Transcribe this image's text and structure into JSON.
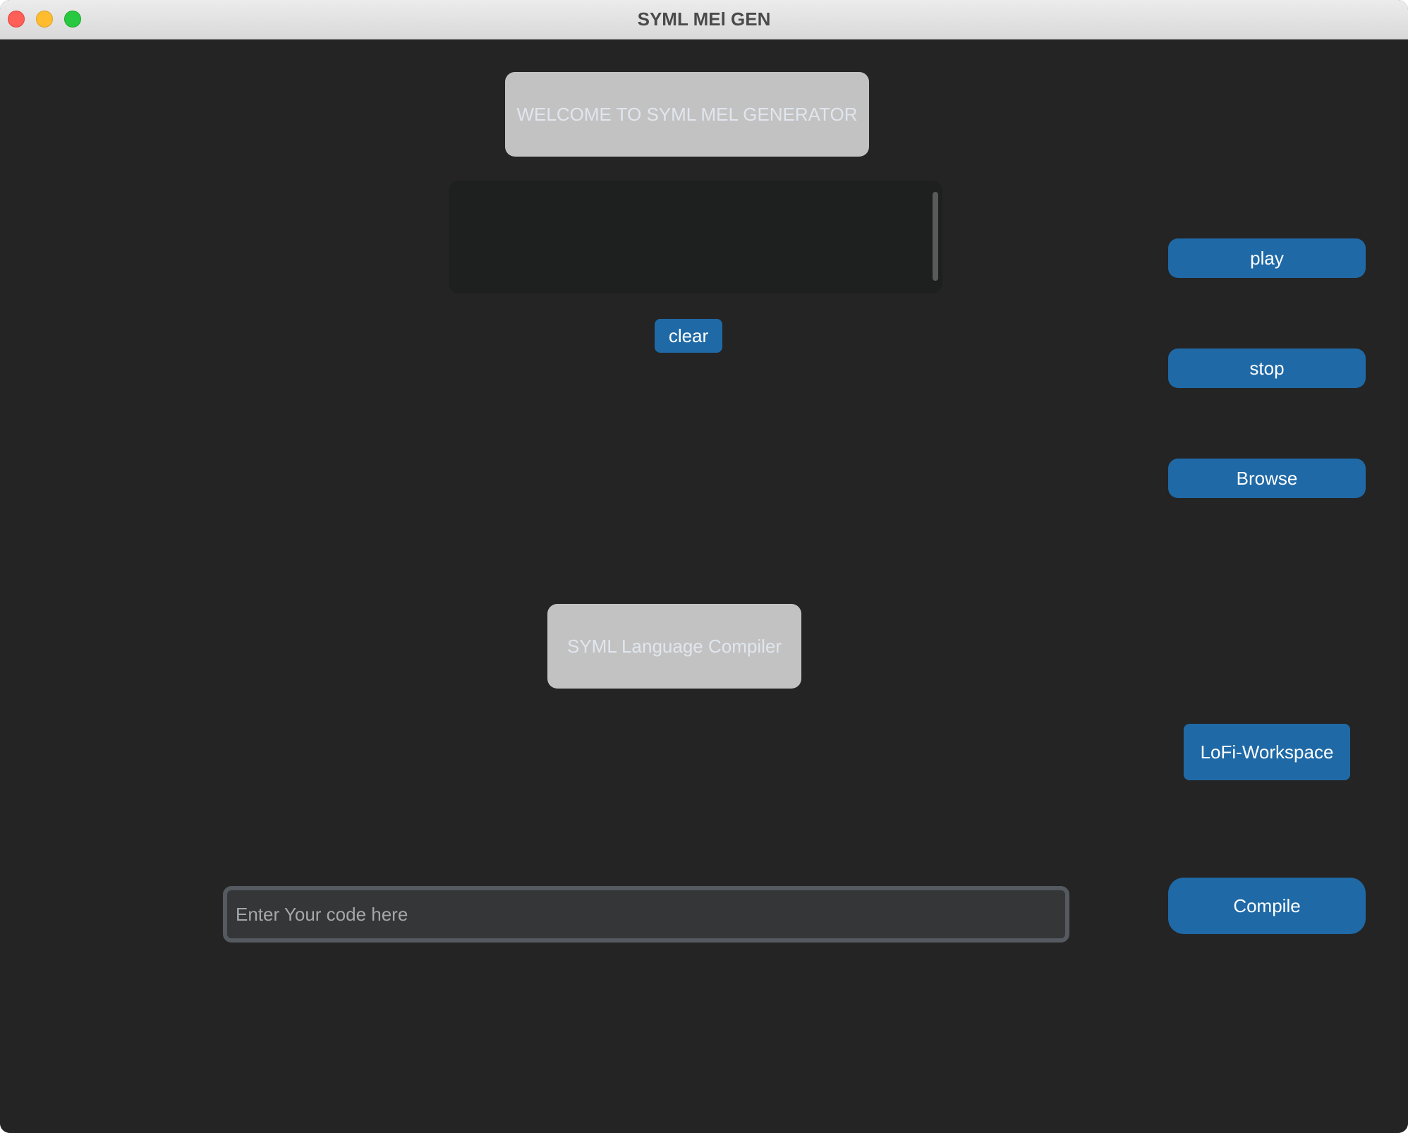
{
  "window": {
    "title": "SYML MEl GEN"
  },
  "labels": {
    "welcome": "WELCOME TO SYML MEL GENERATOR",
    "compiler": "SYML Language Compiler"
  },
  "output": {
    "text": ""
  },
  "buttons": {
    "clear": "clear",
    "play": "play",
    "stop": "stop",
    "browse": "Browse",
    "lofi_workspace": "LoFi-Workspace",
    "compile": "Compile"
  },
  "code_input": {
    "value": "",
    "placeholder": "Enter Your code here"
  },
  "colors": {
    "background": "#242424",
    "button": "#1f69a6",
    "label_box": "#c2c2c2",
    "label_text": "#e1e6ee",
    "output_bg": "#1e1f1f",
    "input_bg": "#343638",
    "input_border": "#555a60",
    "close": "#fe5f57",
    "minimize": "#febc2e",
    "zoom": "#28c840"
  }
}
